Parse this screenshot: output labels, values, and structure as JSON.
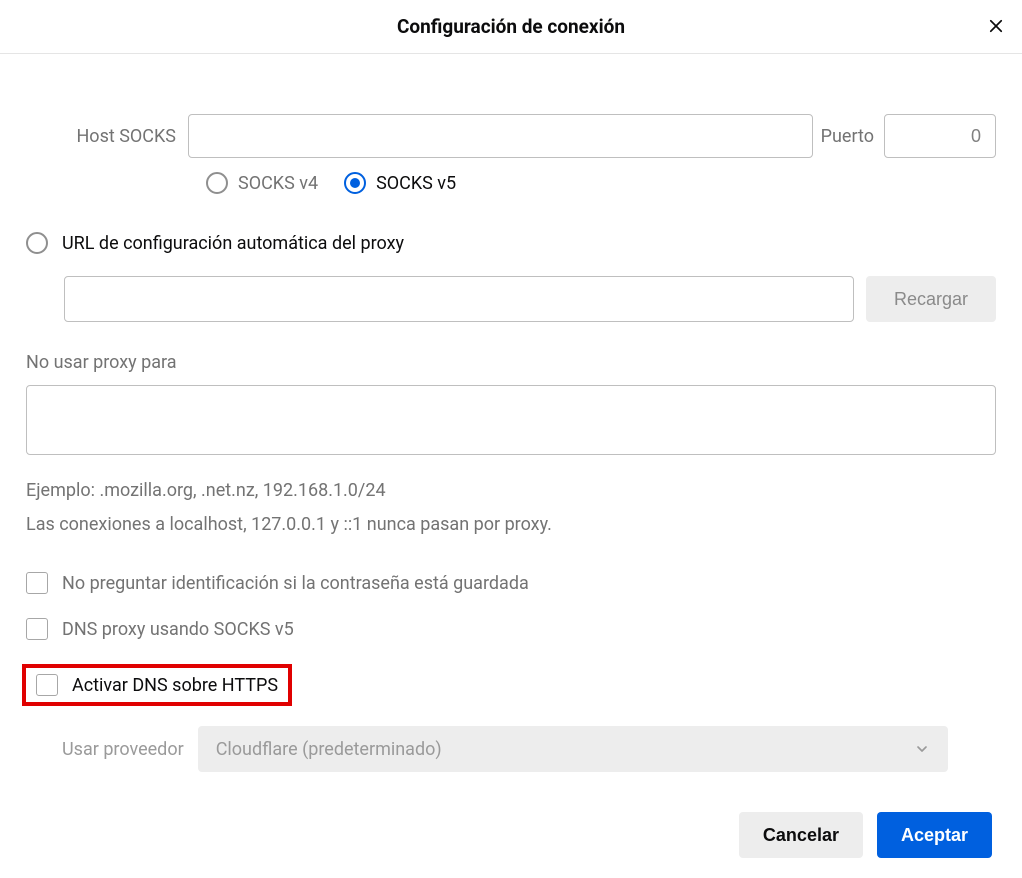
{
  "dialog": {
    "title": "Configuración de conexión"
  },
  "socks": {
    "host_label": "Host SOCKS",
    "host_value": "",
    "port_label": "Puerto",
    "port_value": "0",
    "v4_label": "SOCKS v4",
    "v5_label": "SOCKS v5"
  },
  "proxy": {
    "pac_radio_label": "URL de configuración automática del proxy",
    "pac_url_value": "",
    "reload_label": "Recargar"
  },
  "no_proxy": {
    "label": "No usar proxy para",
    "value": "",
    "example": "Ejemplo: .mozilla.org, .net.nz, 192.168.1.0/24",
    "local_note": "Las conexiones a localhost, 127.0.0.1 y ::1 nunca pasan por proxy."
  },
  "checks": {
    "no_prompt_auth": "No preguntar identificación si la contraseña está guardada",
    "dns_socks5": "DNS proxy usando SOCKS v5",
    "dns_https": "Activar DNS sobre HTTPS"
  },
  "provider": {
    "label": "Usar proveedor",
    "selected": "Cloudflare (predeterminado)"
  },
  "footer": {
    "cancel": "Cancelar",
    "accept": "Aceptar"
  }
}
